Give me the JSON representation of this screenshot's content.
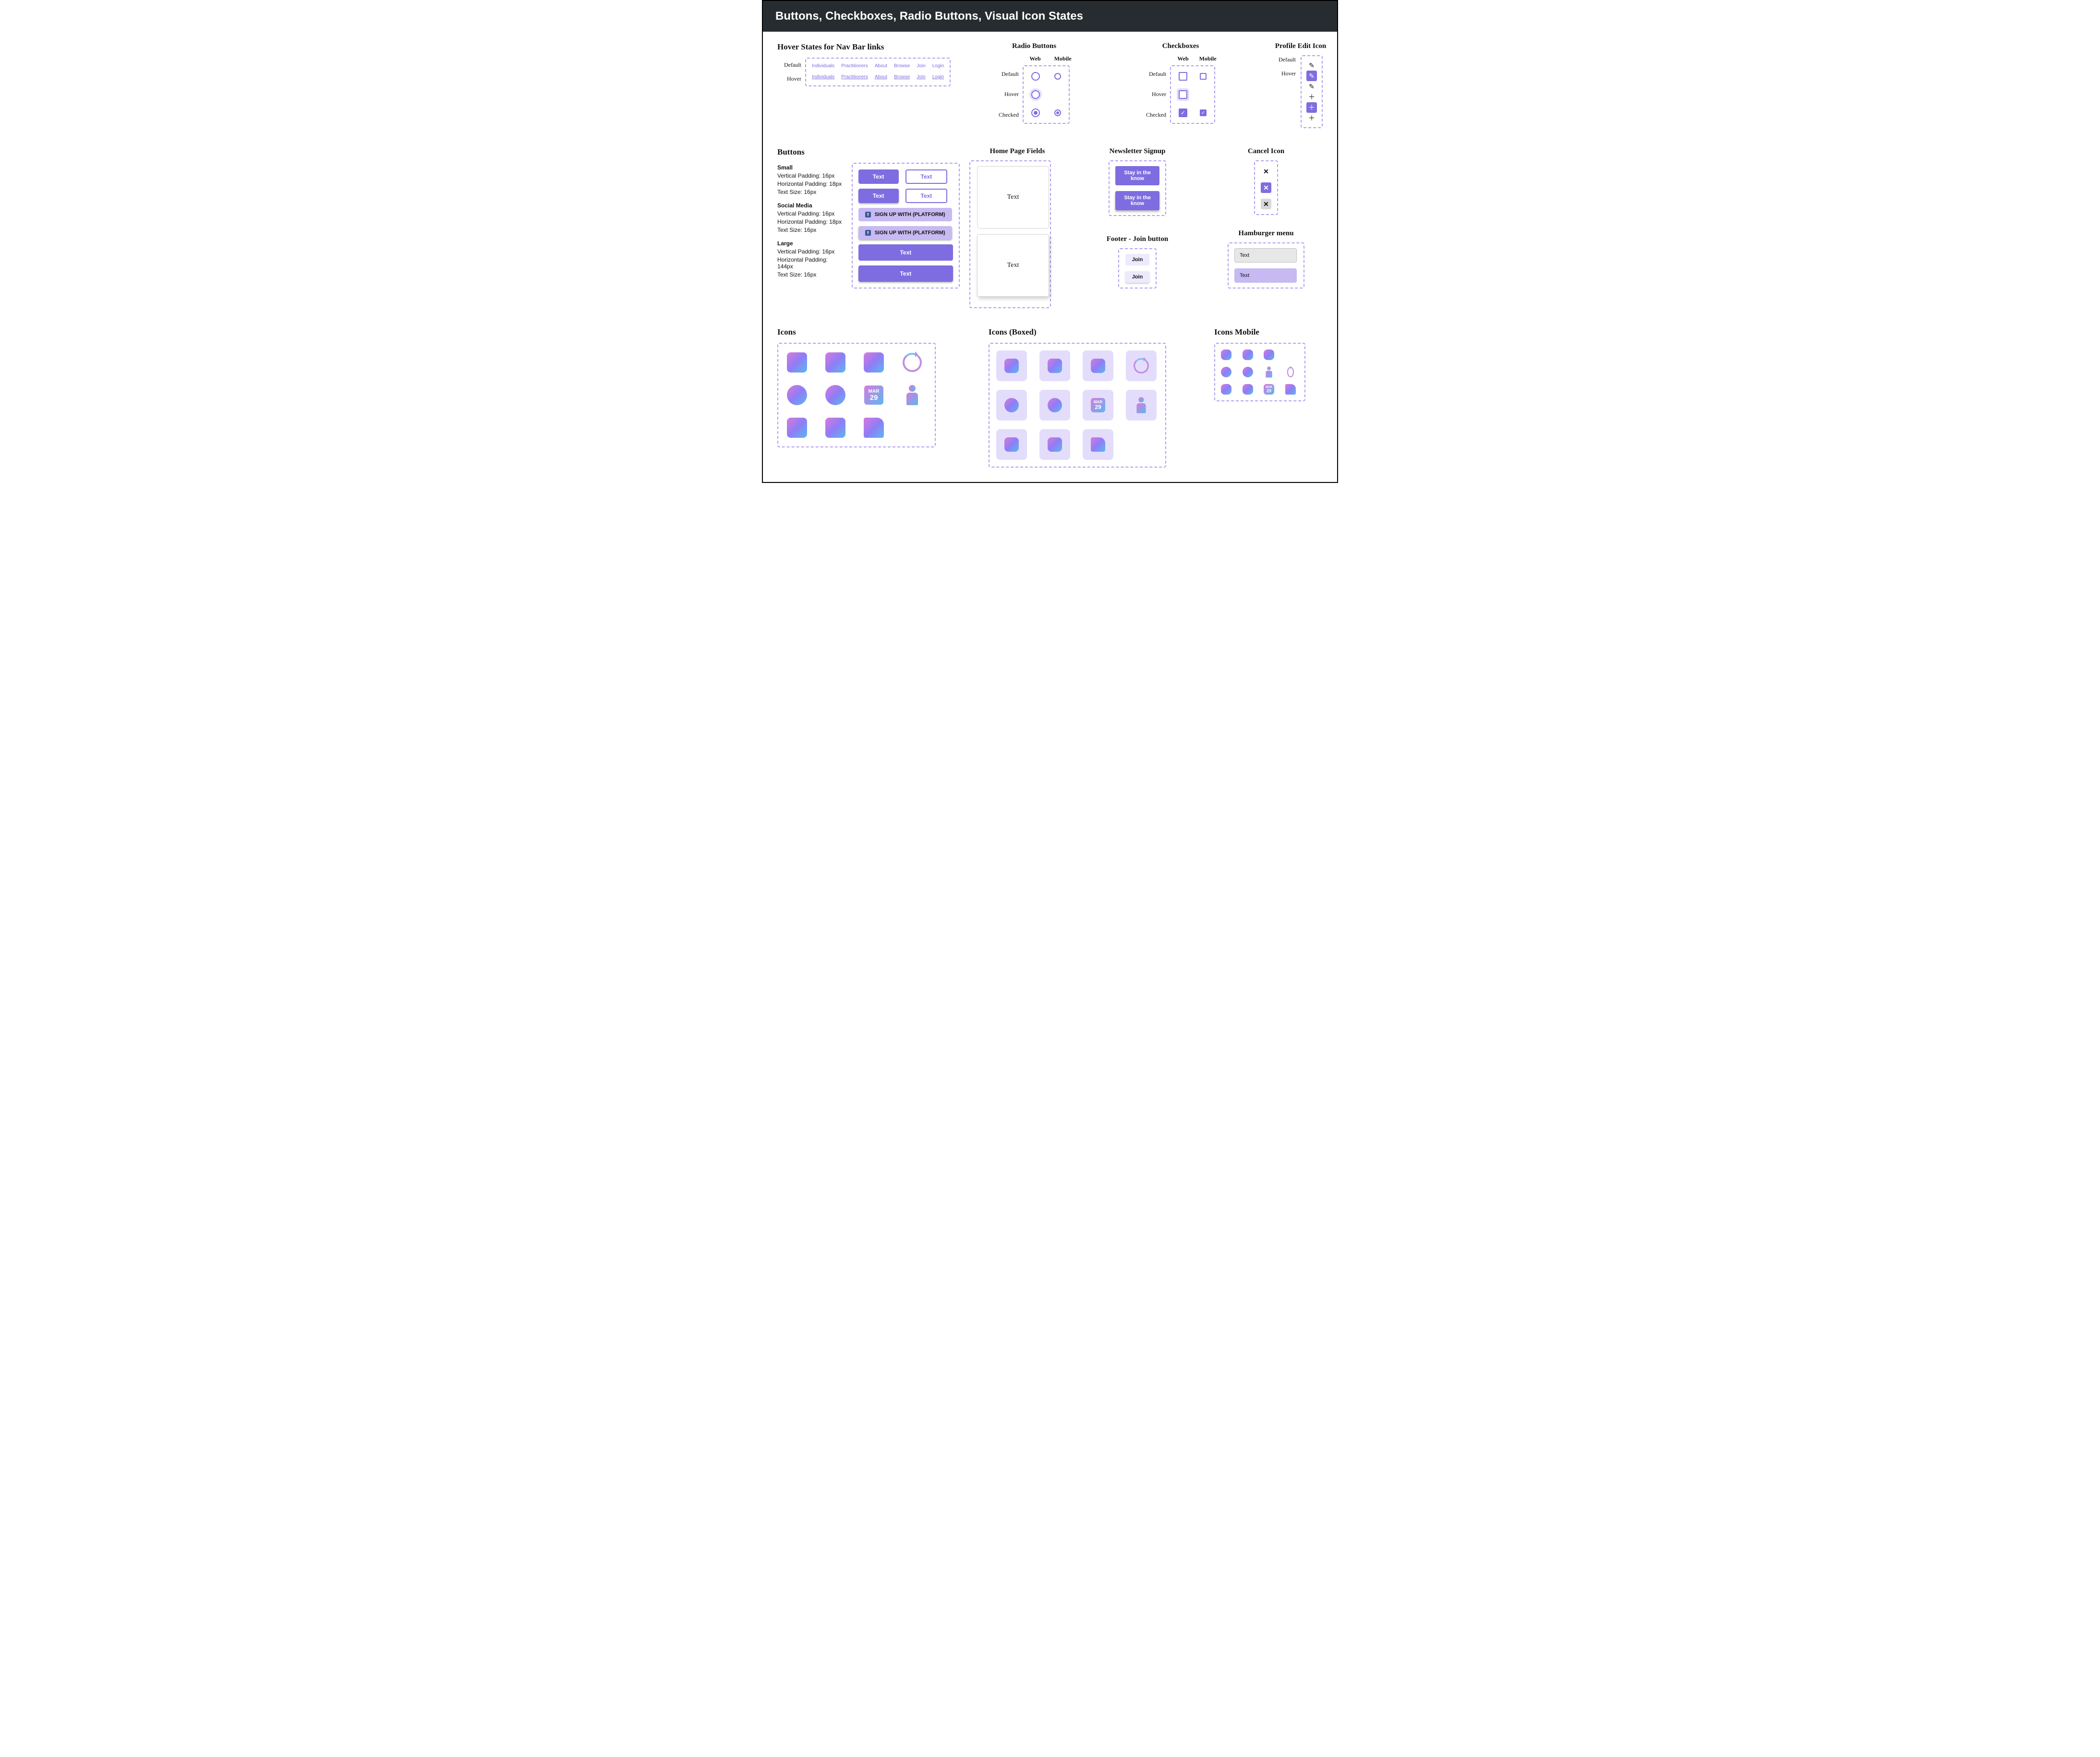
{
  "header": {
    "title": "Buttons, Checkboxes, Radio Buttons, Visual Icon States"
  },
  "nav_hover": {
    "title": "Hover States for Nav Bar links",
    "row_labels": {
      "default": "Default",
      "hover": "Hover"
    },
    "links": [
      "Individuals",
      "Practitioners",
      "About",
      "Browse",
      "Join",
      "Login"
    ]
  },
  "radio": {
    "title": "Radio Buttons",
    "cols": {
      "web": "Web",
      "mobile": "Mobile"
    },
    "rows": {
      "default": "Default",
      "hover": "Hover",
      "checked": "Checked"
    }
  },
  "checkbox": {
    "title": "Checkboxes",
    "cols": {
      "web": "Web",
      "mobile": "Mobile"
    },
    "rows": {
      "default": "Default",
      "hover": "Hover",
      "checked": "Checked"
    }
  },
  "edit_icon": {
    "title": "Profile Edit Icon",
    "rows": {
      "default": "Default",
      "hover": "Hover"
    }
  },
  "buttons": {
    "title": "Buttons",
    "groups": {
      "small": {
        "name": "Small",
        "vp": "Vertical Padding: 16px",
        "hp": "Horizontal Padding: 18px",
        "ts": "Text Size: 16px"
      },
      "social": {
        "name": "Social Media",
        "vp": "Vertical Padding: 16px",
        "hp": "Horizontal Padding: 18px",
        "ts": "Text Size: 16px"
      },
      "large": {
        "name": "Large",
        "vp": "Vertical Padding: 16px",
        "hp": "Horizontal Padding: 144px",
        "ts": "Text Size: 16px"
      }
    },
    "labels": {
      "text": "Text",
      "social": "SIGN UP WITH (PLATFORM)"
    }
  },
  "home_fields": {
    "title": "Home Page Fields",
    "label": "Text"
  },
  "newsletter": {
    "title": "Newsletter Signup",
    "label": "Stay in the know"
  },
  "footer_join": {
    "title": "Footer - Join button",
    "label": "Join"
  },
  "cancel": {
    "title": "Cancel Icon"
  },
  "hamburger": {
    "title": "Hamburger menu",
    "label": "Text"
  },
  "icons": {
    "title": "Icons",
    "title_boxed": "Icons (Boxed)",
    "title_mobile": "Icons Mobile",
    "calendar": {
      "month": "MAR",
      "day": "29"
    },
    "names": [
      "legs-a",
      "legs-b",
      "legs-c",
      "cycle",
      "uterus",
      "clock",
      "calendar",
      "doctor",
      "torso-a",
      "torso-b",
      "stork"
    ]
  }
}
